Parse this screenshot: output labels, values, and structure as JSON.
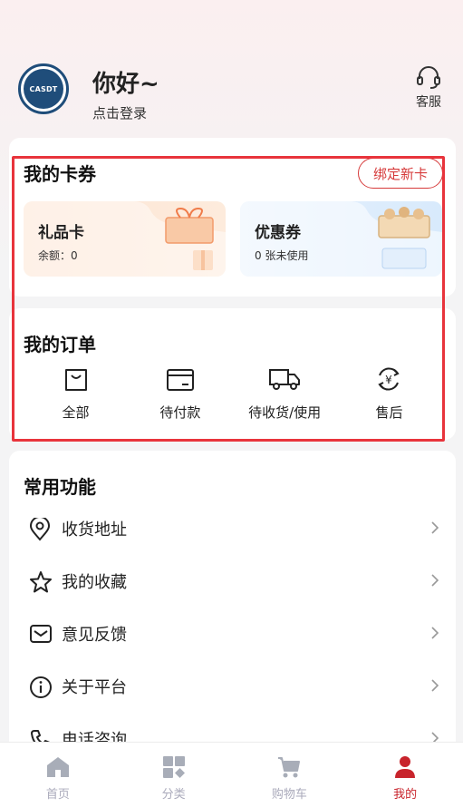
{
  "header": {
    "logo_text": "CASDT",
    "greeting": "你好~",
    "login_text": "点击登录",
    "service_label": "客服"
  },
  "wallet": {
    "title": "我的卡券",
    "bind_button": "绑定新卡",
    "gift_card": {
      "title": "礼品卡",
      "subtitle": "余额：0"
    },
    "coupon": {
      "title": "优惠券",
      "subtitle": "0 张未使用"
    }
  },
  "orders": {
    "title": "我的订单",
    "items": [
      {
        "label": "全部",
        "icon": "bag-icon"
      },
      {
        "label": "待付款",
        "icon": "wallet-card-icon"
      },
      {
        "label": "待收货/使用",
        "icon": "truck-icon"
      },
      {
        "label": "售后",
        "icon": "refund-yuan-icon"
      }
    ]
  },
  "common": {
    "title": "常用功能",
    "items": [
      {
        "label": "收货地址",
        "icon": "location-pin-icon"
      },
      {
        "label": "我的收藏",
        "icon": "star-icon"
      },
      {
        "label": "意见反馈",
        "icon": "mail-icon"
      },
      {
        "label": "关于平台",
        "icon": "info-icon"
      },
      {
        "label": "电话咨询",
        "icon": "phone-icon"
      }
    ]
  },
  "tabbar": {
    "items": [
      {
        "label": "首页",
        "icon": "home-icon",
        "active": false
      },
      {
        "label": "分类",
        "icon": "category-icon",
        "active": false
      },
      {
        "label": "购物车",
        "icon": "cart-icon",
        "active": false
      },
      {
        "label": "我的",
        "icon": "user-icon",
        "active": true
      }
    ]
  },
  "colors": {
    "accent": "#c8242c",
    "highlight_box": "#e8343c",
    "logo_blue": "#1f4d7a"
  }
}
